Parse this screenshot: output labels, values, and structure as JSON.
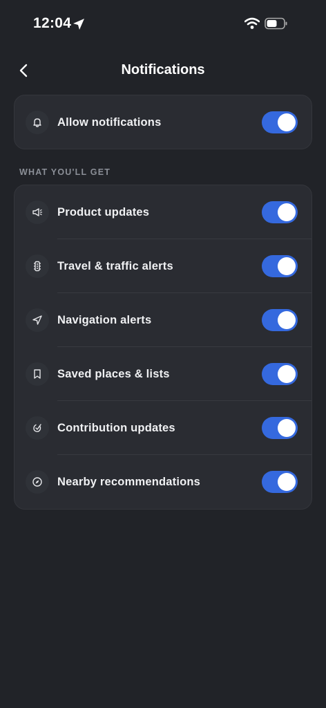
{
  "status_bar": {
    "time": "12:04",
    "icons": [
      "location-arrow-icon",
      "wifi-icon",
      "battery-icon"
    ]
  },
  "nav": {
    "back_icon": "chevron-left-icon",
    "title": "Notifications"
  },
  "allow": {
    "icon": "bell-icon",
    "label": "Allow notifications",
    "enabled": true
  },
  "section": {
    "header": "WHAT YOU'LL GET",
    "items": [
      {
        "icon": "megaphone-icon",
        "label": "Product updates",
        "enabled": true
      },
      {
        "icon": "traffic-light-icon",
        "label": "Travel & traffic alerts",
        "enabled": true
      },
      {
        "icon": "navigation-arrow-icon",
        "label": "Navigation alerts",
        "enabled": true
      },
      {
        "icon": "bookmark-icon",
        "label": "Saved places & lists",
        "enabled": true
      },
      {
        "icon": "contribution-icon",
        "label": "Contribution updates",
        "enabled": true
      },
      {
        "icon": "compass-icon",
        "label": "Nearby recommendations",
        "enabled": true
      }
    ]
  },
  "colors": {
    "background": "#212328",
    "card": "#2a2c32",
    "toggle_on": "#3569de",
    "section_header": "#8b8f97"
  }
}
